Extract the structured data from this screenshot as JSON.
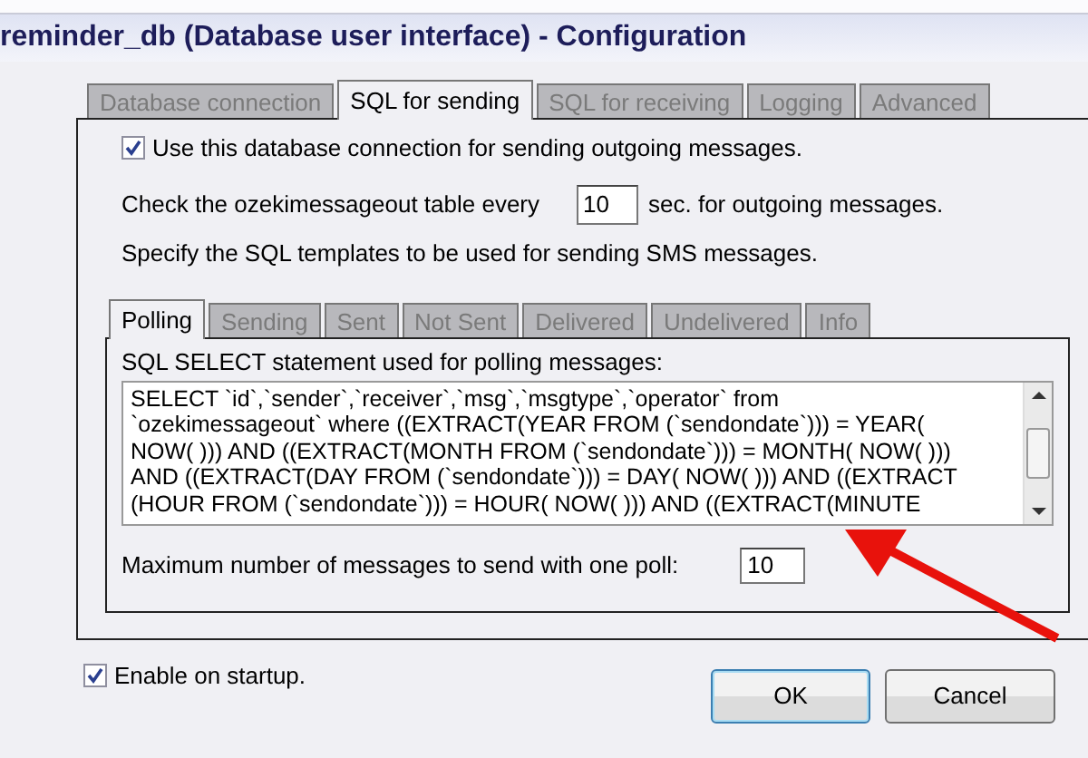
{
  "window": {
    "title": "reminder_db (Database user interface) - Configuration"
  },
  "tabs": [
    {
      "label": "Database connection",
      "selected": false
    },
    {
      "label": "SQL for sending",
      "selected": true
    },
    {
      "label": "SQL for receiving",
      "selected": false
    },
    {
      "label": "Logging",
      "selected": false
    },
    {
      "label": "Advanced",
      "selected": false
    }
  ],
  "use_connection": {
    "label": "Use this database connection for sending outgoing messages.",
    "checked": true
  },
  "check_interval": {
    "label_before": "Check the ozekimessageout table every",
    "value": "10",
    "label_after": "sec. for outgoing messages."
  },
  "templates_note": "Specify the SQL templates to be used for sending SMS messages.",
  "sub_tabs": [
    {
      "label": "Polling",
      "selected": true
    },
    {
      "label": "Sending",
      "selected": false
    },
    {
      "label": "Sent",
      "selected": false
    },
    {
      "label": "Not Sent",
      "selected": false
    },
    {
      "label": "Delivered",
      "selected": false
    },
    {
      "label": "Undelivered",
      "selected": false
    },
    {
      "label": "Info",
      "selected": false
    }
  ],
  "polling": {
    "label": "SQL SELECT statement used for polling messages:",
    "sql": "SELECT `id`,`sender`,`receiver`,`msg`,`msgtype`,`operator` from\n`ozekimessageout` where ((EXTRACT(YEAR FROM (`sendondate`))) = YEAR(\nNOW( ))) AND ((EXTRACT(MONTH FROM (`sendondate`))) = MONTH( NOW( )))\nAND ((EXTRACT(DAY FROM (`sendondate`))) = DAY( NOW( ))) AND ((EXTRACT\n(HOUR FROM (`sendondate`))) = HOUR( NOW( ))) AND ((EXTRACT(MINUTE",
    "max_label": "Maximum number of messages to send with one poll:",
    "max_value": "10"
  },
  "enable_on_startup": {
    "label": "Enable on startup.",
    "checked": true
  },
  "buttons": [
    {
      "label": "OK",
      "default": true
    },
    {
      "label": "Cancel",
      "default": false
    }
  ]
}
